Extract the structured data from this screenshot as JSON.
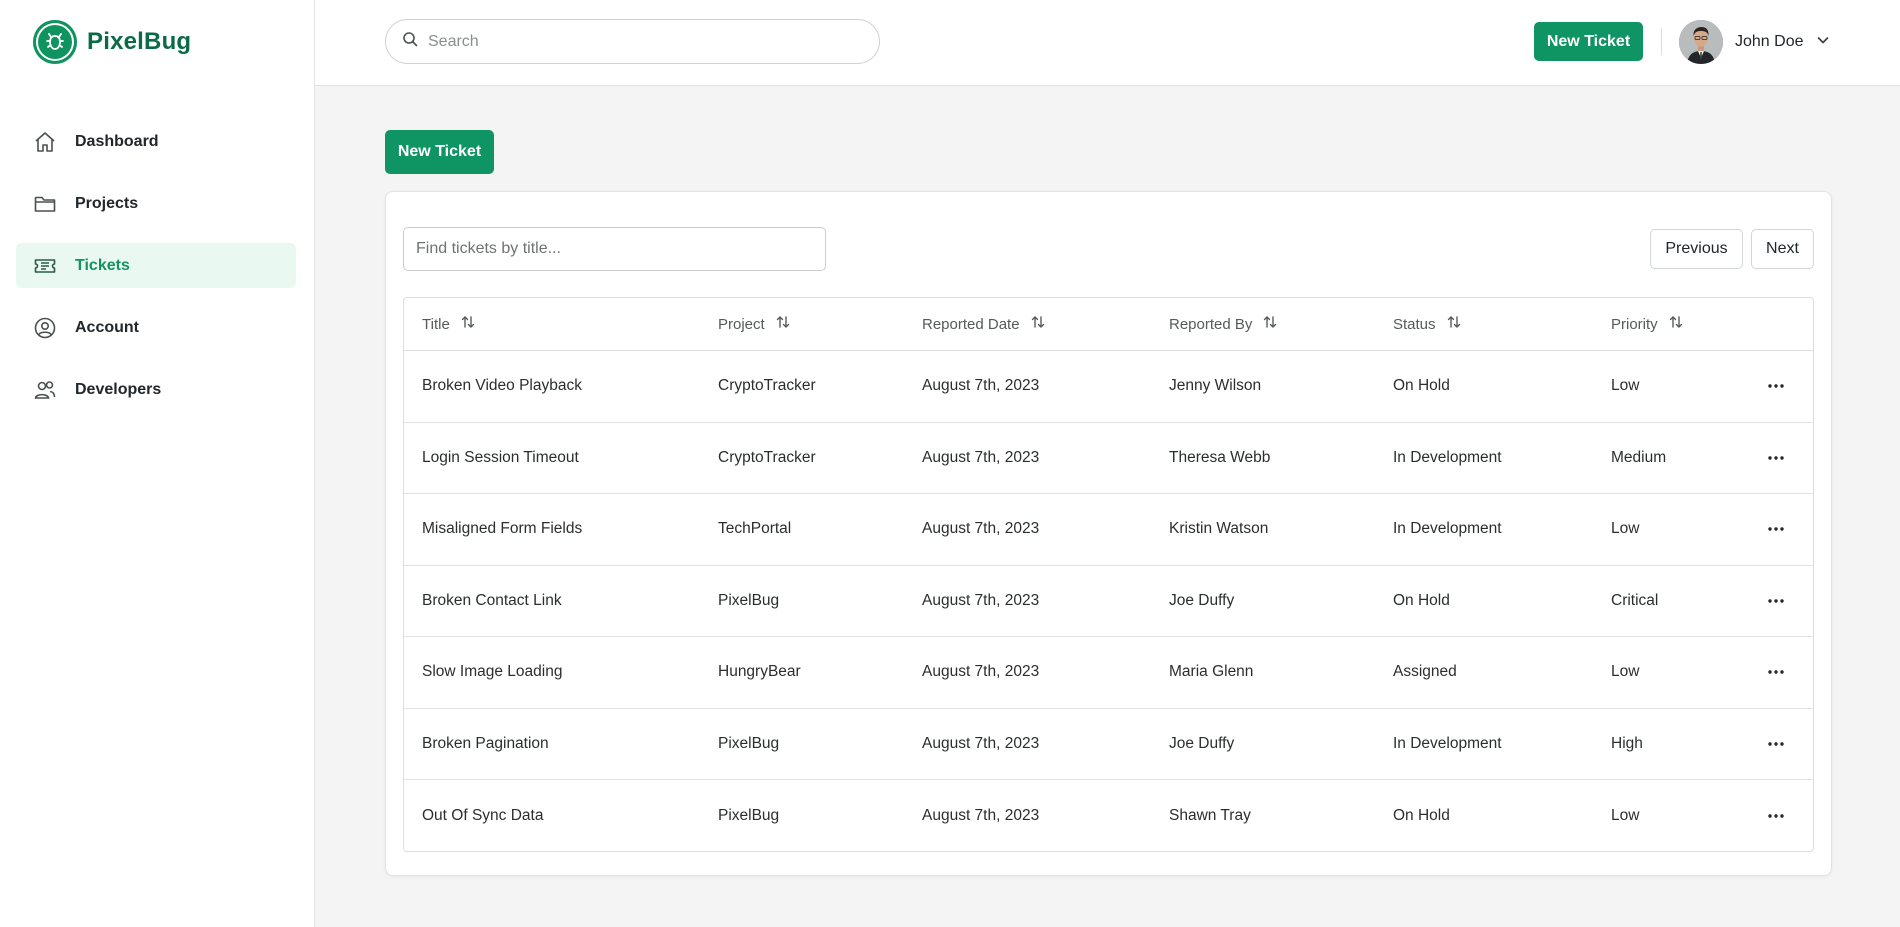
{
  "app": {
    "name": "PixelBug"
  },
  "sidebar": {
    "items": [
      {
        "label": "Dashboard",
        "icon": "home-icon",
        "active": false
      },
      {
        "label": "Projects",
        "icon": "folder-icon",
        "active": false
      },
      {
        "label": "Tickets",
        "icon": "ticket-icon",
        "active": true
      },
      {
        "label": "Account",
        "icon": "user-circle-icon",
        "active": false
      },
      {
        "label": "Developers",
        "icon": "users-icon",
        "active": false
      }
    ]
  },
  "topbar": {
    "search_placeholder": "Search",
    "new_ticket_label": "New Ticket",
    "user_name": "John Doe"
  },
  "main": {
    "new_ticket_label": "New Ticket",
    "filter_placeholder": "Find tickets by title...",
    "previous_label": "Previous",
    "next_label": "Next",
    "columns": [
      "Title",
      "Project",
      "Reported Date",
      "Reported By",
      "Status",
      "Priority"
    ],
    "rows": [
      {
        "title": "Broken Video Playback",
        "project": "CryptoTracker",
        "date": "August 7th, 2023",
        "by": "Jenny Wilson",
        "status": "On Hold",
        "priority": "Low"
      },
      {
        "title": "Login Session Timeout",
        "project": "CryptoTracker",
        "date": "August 7th, 2023",
        "by": "Theresa Webb",
        "status": "In Development",
        "priority": "Medium"
      },
      {
        "title": "Misaligned Form Fields",
        "project": "TechPortal",
        "date": "August 7th, 2023",
        "by": "Kristin Watson",
        "status": "In Development",
        "priority": "Low"
      },
      {
        "title": "Broken Contact Link",
        "project": "PixelBug",
        "date": "August 7th, 2023",
        "by": "Joe Duffy",
        "status": "On Hold",
        "priority": "Critical"
      },
      {
        "title": "Slow Image Loading",
        "project": "HungryBear",
        "date": "August 7th, 2023",
        "by": "Maria Glenn",
        "status": "Assigned",
        "priority": "Low"
      },
      {
        "title": "Broken Pagination",
        "project": "PixelBug",
        "date": "August 7th, 2023",
        "by": "Joe Duffy",
        "status": "In Development",
        "priority": "High"
      },
      {
        "title": "Out Of Sync Data",
        "project": "PixelBug",
        "date": "August 7th, 2023",
        "by": "Shawn Tray",
        "status": "On Hold",
        "priority": "Low"
      }
    ]
  },
  "colors": {
    "brand": "#0f9463",
    "brand_dark": "#0c6b46",
    "active_bg": "#e9f8f0"
  }
}
